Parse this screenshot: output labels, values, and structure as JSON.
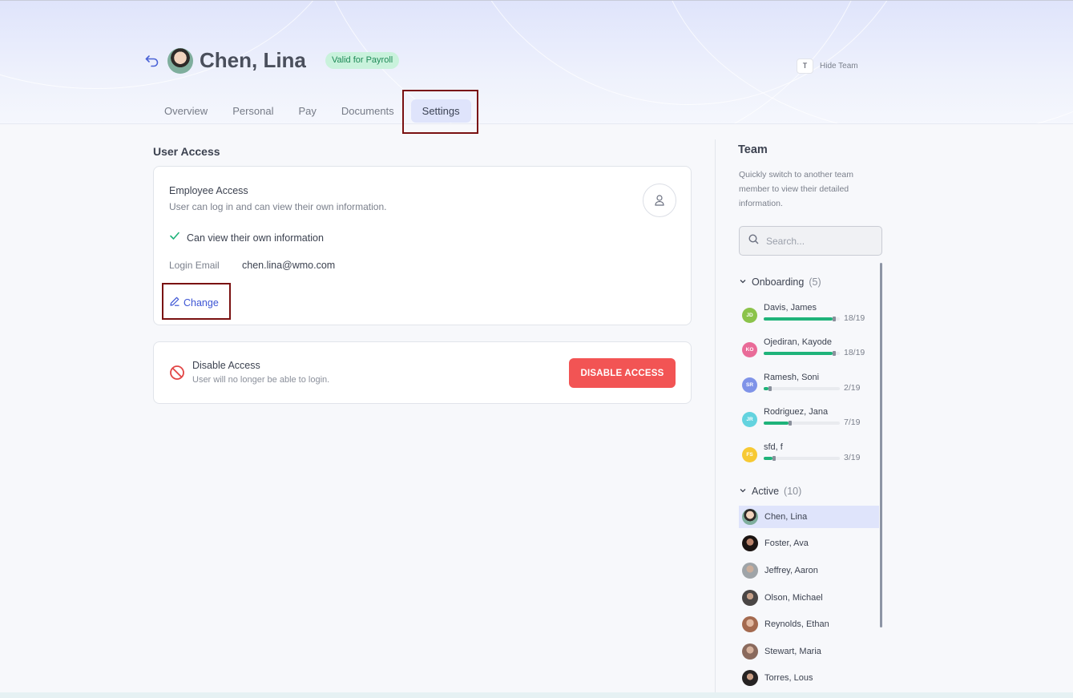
{
  "employee": {
    "name": "Chen, Lina",
    "badge": "Valid for Payroll"
  },
  "header": {
    "hide_team_key": "T",
    "hide_team_label": "Hide Team"
  },
  "tabs": [
    {
      "label": "Overview",
      "active": false
    },
    {
      "label": "Personal",
      "active": false
    },
    {
      "label": "Pay",
      "active": false
    },
    {
      "label": "Documents",
      "active": false
    },
    {
      "label": "Settings",
      "active": true
    }
  ],
  "user_access": {
    "section_title": "User Access",
    "employee_access": {
      "title": "Employee Access",
      "description": "User can log in and can view their own information.",
      "permission": "Can view their own information",
      "login_email_label": "Login Email",
      "login_email_value": "chen.lina@wmo.com",
      "change_label": "Change"
    },
    "disable_access": {
      "title": "Disable Access",
      "description": "User will no longer be able to login.",
      "button_label": "DISABLE ACCESS"
    }
  },
  "team": {
    "title": "Team",
    "description": "Quickly switch to another team member to view their detailed information.",
    "search_placeholder": "Search...",
    "onboarding": {
      "label": "Onboarding",
      "count": "(5)",
      "members": [
        {
          "initials": "JD",
          "name": "Davis, James",
          "progress": "18/19",
          "fraction": 0.947,
          "color": "#8bc34a"
        },
        {
          "initials": "KO",
          "name": "Ojediran, Kayode",
          "progress": "18/19",
          "fraction": 0.947,
          "color": "#e96b98"
        },
        {
          "initials": "SR",
          "name": "Ramesh, Soni",
          "progress": "2/19",
          "fraction": 0.105,
          "color": "#7f93e8"
        },
        {
          "initials": "JR",
          "name": "Rodriguez, Jana",
          "progress": "7/19",
          "fraction": 0.368,
          "color": "#63d3df"
        },
        {
          "initials": "FS",
          "name": "sfd, f",
          "progress": "3/19",
          "fraction": 0.158,
          "color": "#f7c933"
        }
      ]
    },
    "active": {
      "label": "Active",
      "count": "(10)",
      "members": [
        {
          "name": "Chen, Lina",
          "selected": true
        },
        {
          "name": "Foster, Ava",
          "selected": false
        },
        {
          "name": "Jeffrey, Aaron",
          "selected": false
        },
        {
          "name": "Olson, Michael",
          "selected": false
        },
        {
          "name": "Reynolds, Ethan",
          "selected": false
        },
        {
          "name": "Stewart, Maria",
          "selected": false
        },
        {
          "name": "Torres, Lous",
          "selected": false
        }
      ]
    }
  },
  "colors": {
    "accent": "#3d55d4",
    "danger": "#f25454",
    "success": "#1fb37a",
    "highlight_box": "#7a1111"
  }
}
